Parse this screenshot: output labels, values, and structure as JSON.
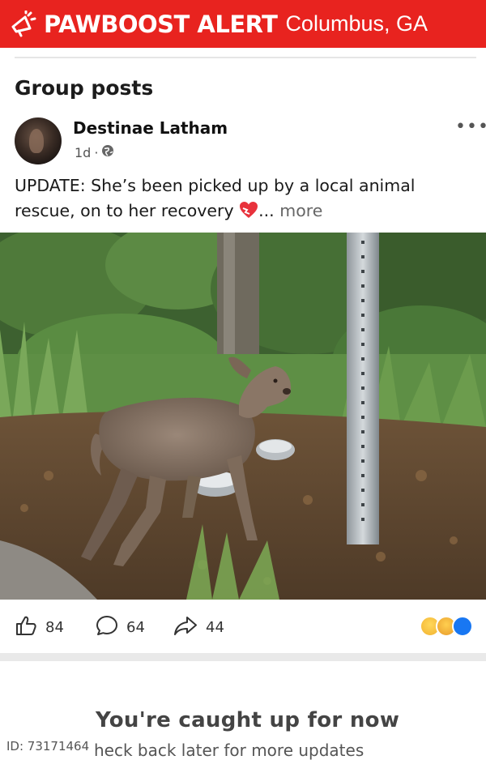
{
  "banner": {
    "brand": "PAWBOOST ALERT",
    "city": "Columbus, GA",
    "color": "#e8231f"
  },
  "section_title": "Group posts",
  "post": {
    "author": "Destinae Latham",
    "time": "1d",
    "text": "UPDATE: She’s been picked up by a local animal rescue, on to her recovery",
    "ellipsis": "...",
    "more": "more",
    "likes": "84",
    "comments": "64",
    "shares": "44"
  },
  "feed_end": {
    "title": "You're caught up for now",
    "subtitle": "heck back later for more updates"
  },
  "id_label": "ID: 73171464"
}
